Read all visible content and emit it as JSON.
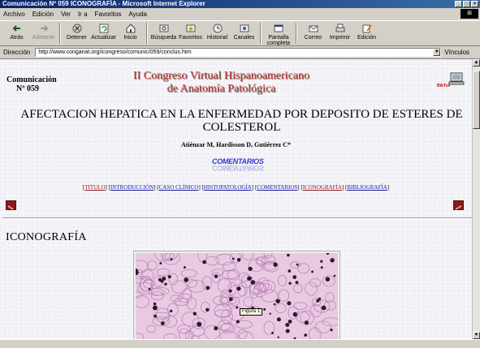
{
  "window": {
    "title": "Comunicación Nº 059 ICONOGRAFÍA - Microsoft Internet Explorer"
  },
  "menu": [
    "Archivo",
    "Edición",
    "Ver",
    "Ir a",
    "Favoritos",
    "Ayuda"
  ],
  "toolbar": {
    "back": "Atrás",
    "forward": "Adelante",
    "stop": "Detener",
    "refresh": "Actualizar",
    "home": "Inicio",
    "search": "Búsqueda",
    "favorites": "Favoritos",
    "history": "Historial",
    "channels": "Canales",
    "fullscreen": "Pantalla completa",
    "mail": "Correo",
    "print": "Imprimir",
    "edit": "Edición"
  },
  "address": {
    "label": "Dirección",
    "url": "http://www.conganat.org/icongreso/comunic/059/conclus.htm",
    "links_label": "Vínculos"
  },
  "page": {
    "comm_line1": "Comunicación",
    "comm_line2": "Nº 059",
    "congress_line1": "II Congreso Virtual Hispanoamericano",
    "congress_line2": "de Anatomía Patológica",
    "bibtex_label": "BibTex",
    "title_line1": "AFECTACION HEPATICA EN LA ENFERMEDAD POR DEPOSITO DE ESTERES DE",
    "title_line2": "COLESTEROL",
    "authors": "Atiénzar M, Hardisson D, Gutiérrez C*",
    "comentarios_logo": "COMENTARIOS",
    "nav": [
      "TITULO",
      "INTRODUCCIÓN",
      "CASO CLÍNICO",
      "HISTOPATOLOGÍA",
      "COMENTARIOS",
      "ICONOGRAFÍA",
      "BIBLIOGRAFÍA"
    ],
    "section_heading": "ICONOGRAFÍA",
    "figure_label": "Figura 1"
  }
}
